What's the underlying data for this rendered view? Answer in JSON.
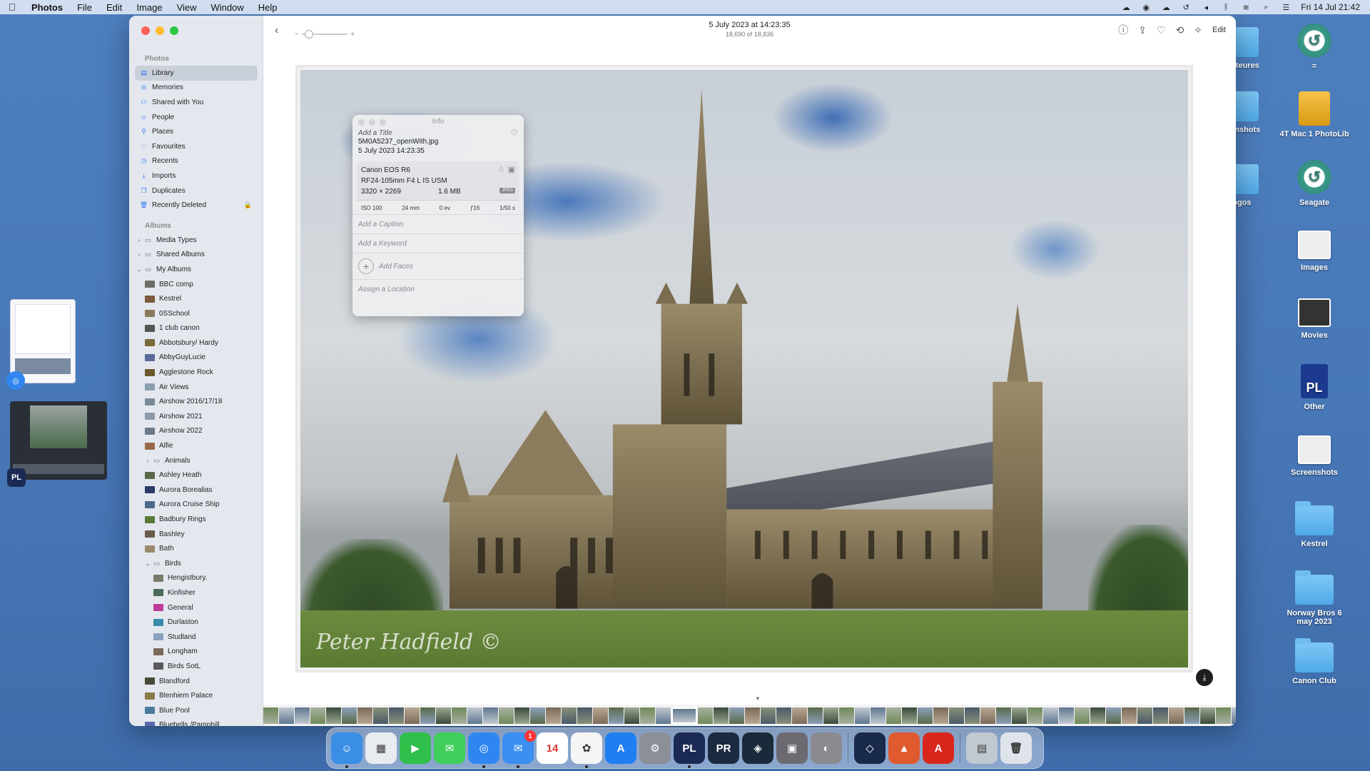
{
  "menubar": {
    "app": "Photos",
    "menus": [
      "File",
      "Edit",
      "Image",
      "View",
      "Window",
      "Help"
    ],
    "clock": "Fri 14 Jul  21:42"
  },
  "toolbar": {
    "date": "5 July 2023 at 14:23:35",
    "count": "18,690 of 18,836",
    "edit_label": "Edit"
  },
  "sidebar": {
    "photos_header": "Photos",
    "albums_header": "Albums",
    "library": [
      {
        "label": "Library",
        "icon": "library-icon"
      },
      {
        "label": "Memories",
        "icon": "memories-icon"
      },
      {
        "label": "Shared with You",
        "icon": "shared-icon"
      },
      {
        "label": "People",
        "icon": "people-icon"
      },
      {
        "label": "Places",
        "icon": "places-icon"
      },
      {
        "label": "Favourites",
        "icon": "heart-icon"
      },
      {
        "label": "Recents",
        "icon": "clock-icon"
      },
      {
        "label": "Imports",
        "icon": "import-icon"
      },
      {
        "label": "Duplicates",
        "icon": "duplicates-icon"
      },
      {
        "label": "Recently Deleted",
        "icon": "trash-icon"
      }
    ],
    "albums": [
      {
        "label": "Media Types",
        "type": "folder",
        "chev": "›",
        "indent": 0
      },
      {
        "label": "Shared Albums",
        "type": "folder",
        "chev": "›",
        "indent": 0
      },
      {
        "label": "My Albums",
        "type": "folder",
        "chev": "⌄",
        "indent": 0
      },
      {
        "label": "BBC comp",
        "type": "album",
        "color": "#6b6e64",
        "indent": 1
      },
      {
        "label": "Kestrel",
        "type": "album",
        "color": "#7a5a3a",
        "indent": 1
      },
      {
        "label": "0SSchool",
        "type": "album",
        "color": "#8a7a5a",
        "indent": 1
      },
      {
        "label": "1 club canon",
        "type": "album",
        "color": "#555",
        "indent": 1
      },
      {
        "label": "Abbotsbury/ Hardy",
        "type": "album",
        "color": "#7a6a3a",
        "indent": 1
      },
      {
        "label": "AbbyGuyLucie",
        "type": "album",
        "color": "#5a6a9a",
        "indent": 1
      },
      {
        "label": "Agglestone Rock",
        "type": "album",
        "color": "#6a5a2a",
        "indent": 1
      },
      {
        "label": "Air Views",
        "type": "album",
        "color": "#8aa0b0",
        "indent": 1
      },
      {
        "label": "Airshow 2016/17/18",
        "type": "album",
        "color": "#7a8a9a",
        "indent": 1
      },
      {
        "label": "Airshow 2021",
        "type": "album",
        "color": "#8a9aaa",
        "indent": 1
      },
      {
        "label": "Airshow 2022",
        "type": "album",
        "color": "#6a7a8a",
        "indent": 1
      },
      {
        "label": "Alfie",
        "type": "album",
        "color": "#9a6a4a",
        "indent": 1
      },
      {
        "label": "Animals",
        "type": "folder",
        "chev": "›",
        "indent": 1
      },
      {
        "label": "Ashley Heath",
        "type": "album",
        "color": "#5a6a4a",
        "indent": 1
      },
      {
        "label": "Aurora Borealias",
        "type": "album",
        "color": "#2a3a6a",
        "indent": 1
      },
      {
        "label": "Aurora Cruise Ship",
        "type": "album",
        "color": "#4a6a8a",
        "indent": 1
      },
      {
        "label": "Badbury Rings",
        "type": "album",
        "color": "#5a7a3a",
        "indent": 1
      },
      {
        "label": "Bashley",
        "type": "album",
        "color": "#6a5a4a",
        "indent": 1
      },
      {
        "label": "Bath",
        "type": "album",
        "color": "#9a8a6a",
        "indent": 1
      },
      {
        "label": "Birds",
        "type": "folder",
        "chev": "⌄",
        "indent": 1
      },
      {
        "label": "Hengistbury.",
        "type": "album",
        "color": "#7a7a6a",
        "indent": 2
      },
      {
        "label": "Kinfisher",
        "type": "album",
        "color": "#4a6a5a",
        "indent": 2
      },
      {
        "label": "General",
        "type": "album",
        "color": "#c03a9a",
        "indent": 2
      },
      {
        "label": "Durlaston",
        "type": "album",
        "color": "#3a8aaa",
        "indent": 2
      },
      {
        "label": "Studland",
        "type": "album",
        "color": "#8aa0c0",
        "indent": 2
      },
      {
        "label": "Longham",
        "type": "album",
        "color": "#7a6a5a",
        "indent": 2
      },
      {
        "label": "Birds SotL",
        "type": "album",
        "color": "#5a5a5a",
        "indent": 2
      },
      {
        "label": "Blandford",
        "type": "album",
        "color": "#4a4a3a",
        "indent": 1
      },
      {
        "label": "Blenhiem Palace",
        "type": "album",
        "color": "#8a7a4a",
        "indent": 1
      },
      {
        "label": "Blue Pool",
        "type": "album",
        "color": "#4a7a9a",
        "indent": 1
      },
      {
        "label": "Bluebells /Pamphill",
        "type": "album",
        "color": "#5a6aaa",
        "indent": 1
      }
    ]
  },
  "info_panel": {
    "header": "Info",
    "title_placeholder": "Add a Title",
    "filename": "5M0A5237_openWith.jpg",
    "datetime": "5 July 2023   14:23:35",
    "camera": "Canon EOS R6",
    "lens": "RF24-105mm F4 L IS USM",
    "dimensions": "3320 × 2269",
    "filesize": "1.6 MB",
    "format_badge": "JPEG",
    "exif": [
      "ISO 100",
      "24 mm",
      "0 ev",
      "ƒ16",
      "1/50 s"
    ],
    "caption_placeholder": "Add a Caption",
    "keyword_placeholder": "Add a Keyword",
    "faces_label": "Add Faces",
    "location_placeholder": "Assign a Location"
  },
  "photo": {
    "watermark": "Peter Hadfield ©"
  },
  "desktop_icons": [
    {
      "label": "ignateures",
      "kind": "folder"
    },
    {
      "label": "=",
      "kind": "timemachine"
    },
    {
      "label": "creenshots",
      "kind": "folder"
    },
    {
      "label": "4T Mac 1 PhotoLib",
      "kind": "drive"
    },
    {
      "label": "Logos",
      "kind": "folder"
    },
    {
      "label": "Seagate",
      "kind": "timemachine"
    },
    {
      "label": "Images",
      "kind": "file"
    },
    {
      "label": "Movies",
      "kind": "movie"
    },
    {
      "label": "Other",
      "kind": "pl"
    },
    {
      "label": "Screenshots",
      "kind": "file"
    },
    {
      "label": "Kestrel",
      "kind": "folder"
    },
    {
      "label": "Norway Bros  6 may 2023",
      "kind": "folder"
    },
    {
      "label": "Canon Club",
      "kind": "folder"
    }
  ],
  "dock": {
    "apps": [
      {
        "name": "finder",
        "color": "#3a8ee6",
        "glyph": "☺",
        "dot": true
      },
      {
        "name": "launchpad",
        "color": "#e8ecf0",
        "glyph": "▦"
      },
      {
        "name": "facetime",
        "color": "#2fbf4a",
        "glyph": "▶"
      },
      {
        "name": "messages",
        "color": "#3fcf5a",
        "glyph": "✉"
      },
      {
        "name": "safari",
        "color": "#2f86f0",
        "glyph": "◎",
        "dot": true
      },
      {
        "name": "mail",
        "color": "#3a8ff0",
        "glyph": "✉",
        "badge": "1",
        "dot": true
      },
      {
        "name": "calendar",
        "color": "#ffffff",
        "glyph": "14"
      },
      {
        "name": "photos",
        "color": "#f5f5f5",
        "glyph": "✿",
        "dot": true
      },
      {
        "name": "app-store",
        "color": "#1f7ff0",
        "glyph": "A"
      },
      {
        "name": "system-settings",
        "color": "#8a8f98",
        "glyph": "⚙"
      },
      {
        "name": "photolab",
        "color": "#1b2a55",
        "glyph": "PL",
        "dot": true
      },
      {
        "name": "pureraw",
        "color": "#1b2a40",
        "glyph": "PR"
      },
      {
        "name": "filmpack",
        "color": "#1a2a3a",
        "glyph": "◈"
      },
      {
        "name": "image-capture",
        "color": "#6a6a70",
        "glyph": "▣"
      },
      {
        "name": "preview",
        "color": "#8a8a90",
        "glyph": "◐"
      },
      {
        "name": "sep",
        "color": "",
        "glyph": ""
      },
      {
        "name": "viewpoint",
        "color": "#1a2a4a",
        "glyph": "◇"
      },
      {
        "name": "affinity",
        "color": "#e05a30",
        "glyph": "▲"
      },
      {
        "name": "acrobat",
        "color": "#d9261c",
        "glyph": "A"
      },
      {
        "name": "sep",
        "color": "",
        "glyph": ""
      },
      {
        "name": "stack",
        "color": "#c0c8d0",
        "glyph": "▤"
      },
      {
        "name": "trash",
        "color": "#dfe4ea",
        "glyph": "🗑"
      }
    ]
  }
}
